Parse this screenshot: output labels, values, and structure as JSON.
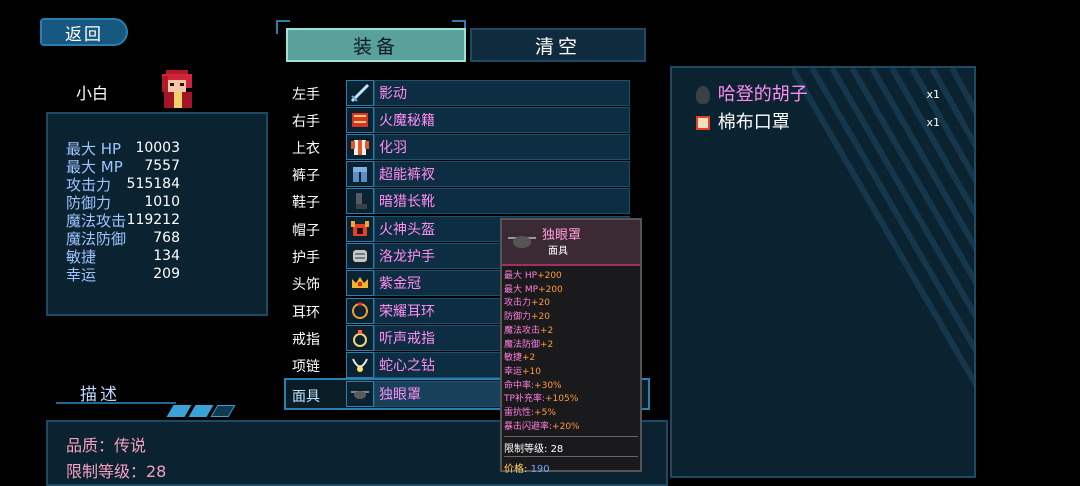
{
  "nav": {
    "back_label": "返回"
  },
  "character": {
    "name": "小白"
  },
  "stats": [
    {
      "label": "最大 HP",
      "value": "10003"
    },
    {
      "label": "最大 MP",
      "value": "7557"
    },
    {
      "label": "攻击力",
      "value": "515184"
    },
    {
      "label": "防御力",
      "value": "1010"
    },
    {
      "label": "魔法攻击",
      "value": "119212"
    },
    {
      "label": "魔法防御",
      "value": "768"
    },
    {
      "label": "敏捷",
      "value": "134"
    },
    {
      "label": "幸运",
      "value": "209"
    }
  ],
  "tabs": {
    "equip": "装备",
    "clear": "清空"
  },
  "equipment": [
    {
      "slot": "左手",
      "item": "影动",
      "icon": "sword-icon"
    },
    {
      "slot": "右手",
      "item": "火魔秘籍",
      "icon": "book-icon"
    },
    {
      "slot": "上衣",
      "item": "化羽",
      "icon": "robe-icon"
    },
    {
      "slot": "裤子",
      "item": "超能裤衩",
      "icon": "pants-icon"
    },
    {
      "slot": "鞋子",
      "item": "暗猎长靴",
      "icon": "boots-icon"
    },
    {
      "slot": "帽子",
      "item": "火神头盔",
      "icon": "helmet-icon"
    },
    {
      "slot": "护手",
      "item": "洛龙护手",
      "icon": "gauntlet-icon"
    },
    {
      "slot": "头饰",
      "item": "紫金冠",
      "icon": "crown-icon"
    },
    {
      "slot": "耳环",
      "item": "荣耀耳环",
      "icon": "earring-icon"
    },
    {
      "slot": "戒指",
      "item": "听声戒指",
      "icon": "ring-icon"
    },
    {
      "slot": "项链",
      "item": "蛇心之钻",
      "icon": "necklace-icon"
    },
    {
      "slot": "面具",
      "item": "独眼罩",
      "icon": "eyepatch-icon"
    }
  ],
  "description": {
    "title": "描述",
    "quality": "品质：传说",
    "level_limit": "限制等级：28"
  },
  "inventory": [
    {
      "name": "哈登的胡子",
      "count": "x1",
      "color": "#ff8cf0",
      "icon": "beard-icon"
    },
    {
      "name": "棉布口罩",
      "count": "x1",
      "color": "#ffffff",
      "icon": "mask-icon"
    }
  ],
  "tooltip": {
    "name": "独眼罩",
    "type": "面具",
    "stats": [
      {
        "label": "最大 HP",
        "value": "+200"
      },
      {
        "label": "最大 MP",
        "value": "+200"
      },
      {
        "label": "攻击力",
        "value": "+20"
      },
      {
        "label": "防御力",
        "value": "+20"
      },
      {
        "label": "魔法攻击",
        "value": "+2"
      },
      {
        "label": "魔法防御",
        "value": "+2"
      },
      {
        "label": "敏捷",
        "value": "+2"
      },
      {
        "label": "幸运",
        "value": "+10"
      },
      {
        "label": "命中率:",
        "value": "+30%"
      },
      {
        "label": "TP补充率:",
        "value": "+105%"
      },
      {
        "label": "雷抗性:",
        "value": "+5%"
      },
      {
        "label": "暴击闪避率:",
        "value": "+20%"
      }
    ],
    "limit_label": "限制等级:",
    "limit_value": "28",
    "price_label": "价格:",
    "price_value": "190"
  },
  "colors": {
    "accent": "#2b7fae",
    "panel": "#0b2231",
    "item_name": "#ff8cf0"
  }
}
